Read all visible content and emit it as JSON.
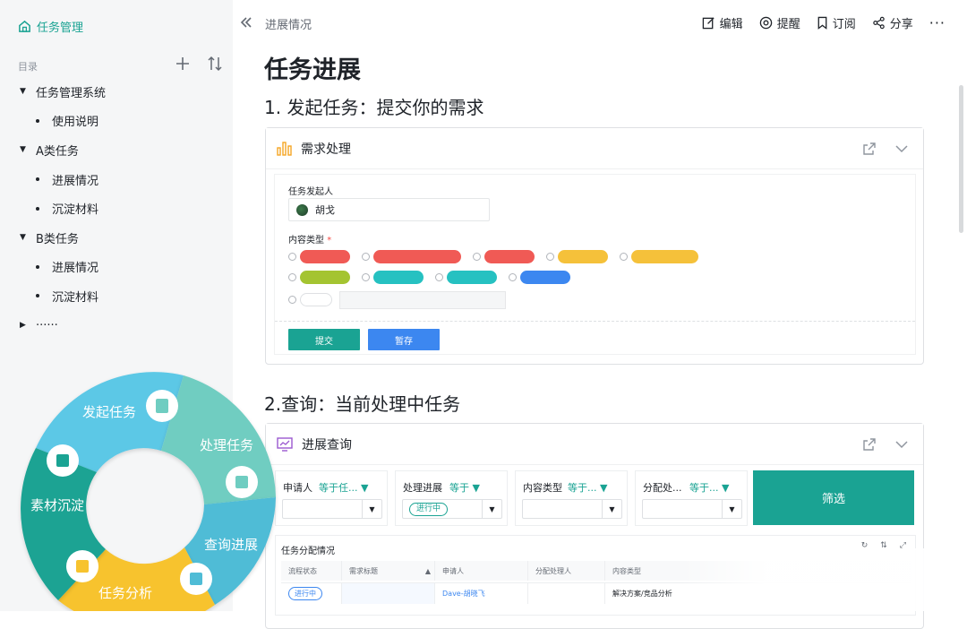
{
  "sidebar": {
    "title": "任务管理",
    "dir_label": "目录",
    "items": [
      {
        "label": "任务管理系统",
        "level": 0
      },
      {
        "label": "使用说明",
        "level": 1
      },
      {
        "label": "A类任务",
        "level": 0
      },
      {
        "label": "进展情况",
        "level": 1
      },
      {
        "label": "沉淀材料",
        "level": 1
      },
      {
        "label": "B类任务",
        "level": 0
      },
      {
        "label": "进展情况",
        "level": 1
      },
      {
        "label": "沉淀材料",
        "level": 1
      },
      {
        "label": "······",
        "level": 0
      }
    ]
  },
  "topbar": {
    "breadcrumb": "进展情况",
    "edit": "编辑",
    "remind": "提醒",
    "subscribe": "订阅",
    "share": "分享"
  },
  "doc": {
    "title": "任务进展",
    "section1": "1. 发起任务：提交你的需求",
    "section2": "2.查询：当前处理中任务"
  },
  "card1": {
    "title": "需求处理",
    "initiator_label": "任务发起人",
    "initiator": "胡戈",
    "type_label": "内容类型",
    "required_mark": "*",
    "submit": "提交",
    "save": "暂存",
    "options_row1": [
      "#f05a55",
      "#f05a55",
      "#f05a55",
      "#f5c13a",
      "#f5c13a"
    ],
    "options_row2": [
      "#a4c431",
      "#26c1c1",
      "#26c1c1",
      "#3c87f0"
    ]
  },
  "card2": {
    "title": "进展查询",
    "filters": [
      {
        "label": "申请人",
        "op": "等于任...",
        "value": ""
      },
      {
        "label": "处理进展",
        "op": "等于",
        "value": "进行中"
      },
      {
        "label": "内容类型",
        "op": "等于...",
        "value": ""
      },
      {
        "label": "分配处...",
        "op": "等于...",
        "value": ""
      }
    ],
    "filter_btn": "筛选",
    "table_title": "任务分配情况",
    "columns": [
      "流程状态",
      "需求标题",
      "申请人",
      "分配处理人",
      "内容类型"
    ],
    "rows": [
      {
        "status": "进行中",
        "title": "",
        "applicant": "Dave-胡晓飞",
        "handler": "",
        "type": "解决方案/竞品分析"
      }
    ]
  },
  "wheel": {
    "labels": [
      "发起任务",
      "处理任务",
      "查询进展",
      "任务分析",
      "素材沉淀"
    ]
  },
  "colors": {
    "accent": "#1aa393",
    "wheel": [
      "#5cc8e6",
      "#6fcdc1",
      "#4fbcd6",
      "#f7c32f",
      "#1aa393"
    ]
  }
}
